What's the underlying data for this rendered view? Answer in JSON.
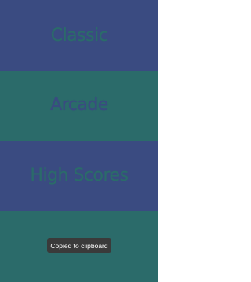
{
  "colors": {
    "blue_band": "#3a4b81",
    "teal_band": "#2b6b6a",
    "text_on_blue": "#2b6b6a",
    "text_on_teal": "#3a4b81",
    "toast_bg": "#3a3a3a",
    "toast_text": "#ffffff"
  },
  "menu": {
    "items": [
      {
        "label": "Classic"
      },
      {
        "label": "Arcade"
      },
      {
        "label": "High Scores"
      },
      {
        "label": ""
      }
    ]
  },
  "toast": {
    "text": "Copied to clipboard"
  }
}
